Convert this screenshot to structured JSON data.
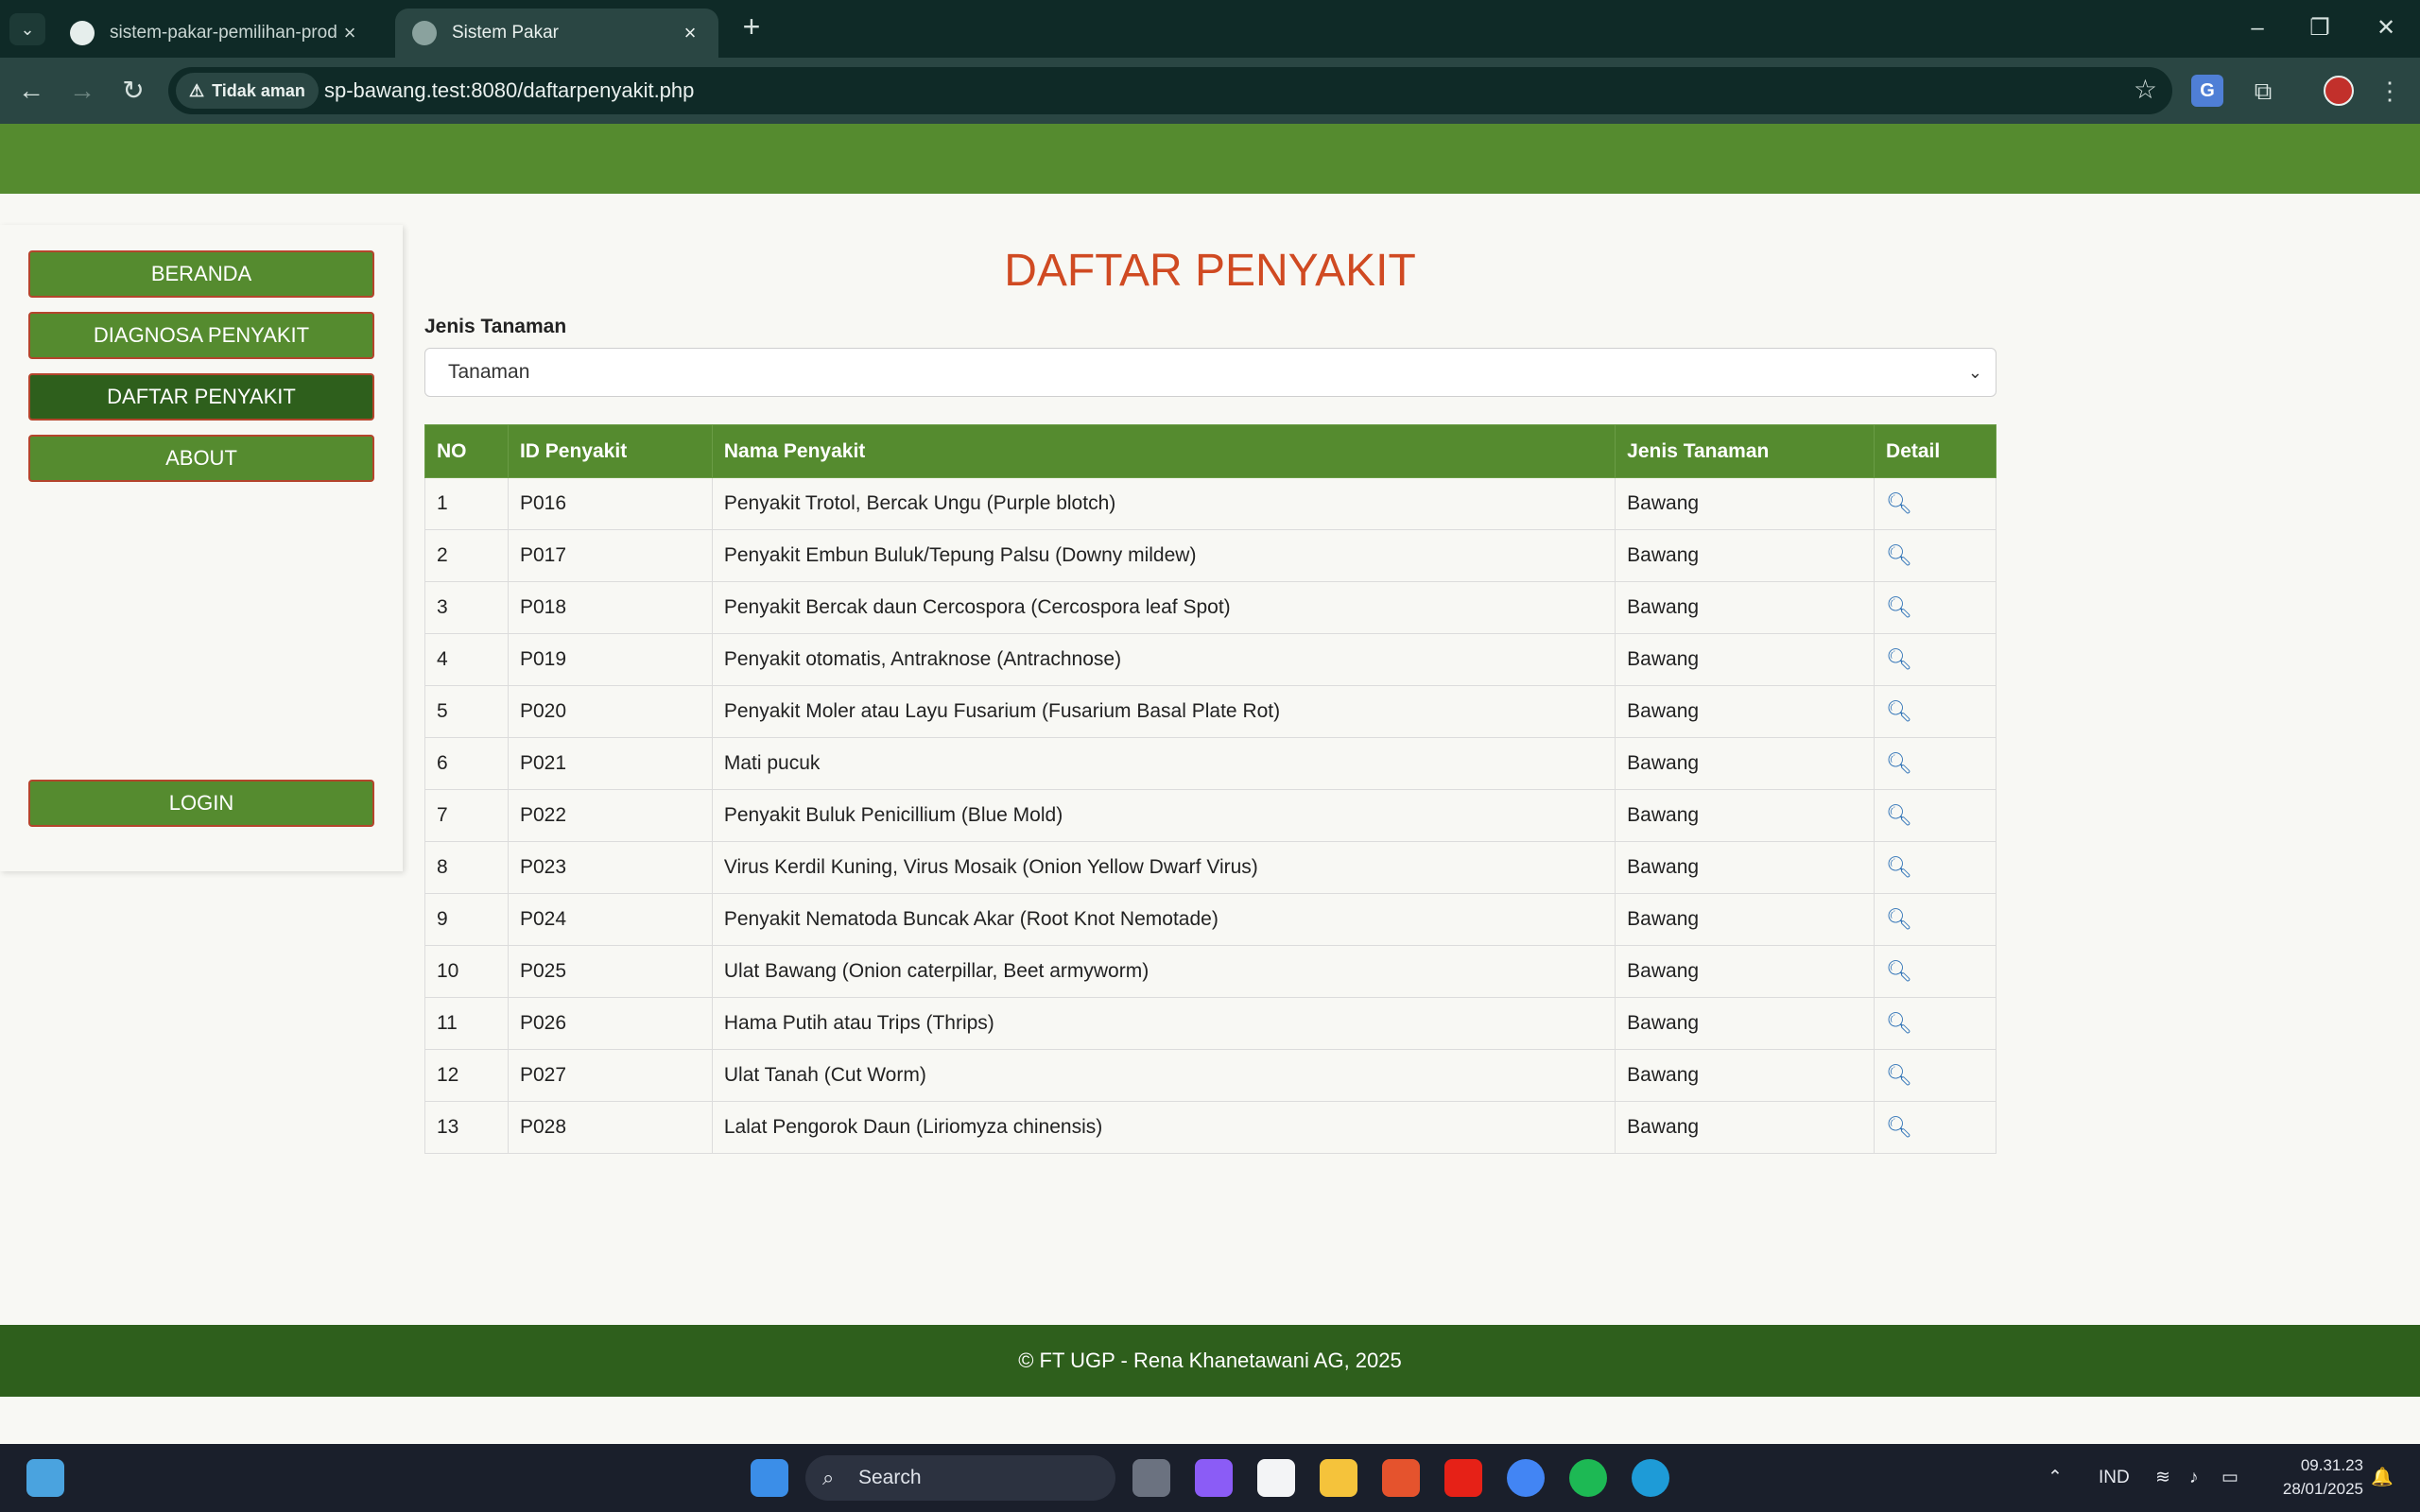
{
  "browser": {
    "tabs": [
      {
        "title": "sistem-pakar-pemilihan-prodi/I"
      },
      {
        "title": "Sistem Pakar"
      }
    ],
    "security_label": "Tidak aman",
    "url": "sp-bawang.test:8080/daftarpenyakit.php"
  },
  "sidebar": {
    "items": [
      {
        "label": "BERANDA"
      },
      {
        "label": "DIAGNOSA PENYAKIT"
      },
      {
        "label": "DAFTAR PENYAKIT"
      },
      {
        "label": "ABOUT"
      }
    ],
    "login_label": "LOGIN"
  },
  "main": {
    "title": "DAFTAR PENYAKIT",
    "filter_label": "Jenis Tanaman",
    "filter_selected": "Tanaman",
    "columns": [
      "NO",
      "ID Penyakit",
      "Nama Penyakit",
      "Jenis Tanaman",
      "Detail"
    ],
    "rows": [
      {
        "no": "1",
        "id": "P016",
        "nama": "Penyakit Trotol, Bercak Ungu (Purple blotch)",
        "jenis": "Bawang"
      },
      {
        "no": "2",
        "id": "P017",
        "nama": "Penyakit Embun Buluk/Tepung Palsu (Downy mildew)",
        "jenis": "Bawang"
      },
      {
        "no": "3",
        "id": "P018",
        "nama": "Penyakit Bercak daun Cercospora (Cercospora leaf Spot)",
        "jenis": "Bawang"
      },
      {
        "no": "4",
        "id": "P019",
        "nama": "Penyakit otomatis, Antraknose (Antrachnose)",
        "jenis": "Bawang"
      },
      {
        "no": "5",
        "id": "P020",
        "nama": "Penyakit Moler atau Layu Fusarium (Fusarium Basal Plate Rot)",
        "jenis": "Bawang"
      },
      {
        "no": "6",
        "id": "P021",
        "nama": "Mati pucuk",
        "jenis": "Bawang"
      },
      {
        "no": "7",
        "id": "P022",
        "nama": "Penyakit Buluk Penicillium (Blue Mold)",
        "jenis": "Bawang"
      },
      {
        "no": "8",
        "id": "P023",
        "nama": "Virus Kerdil Kuning, Virus Mosaik (Onion Yellow Dwarf Virus)",
        "jenis": "Bawang"
      },
      {
        "no": "9",
        "id": "P024",
        "nama": "Penyakit Nematoda Buncak Akar (Root Knot Nemotade)",
        "jenis": "Bawang"
      },
      {
        "no": "10",
        "id": "P025",
        "nama": "Ulat Bawang (Onion caterpillar, Beet armyworm)",
        "jenis": "Bawang"
      },
      {
        "no": "11",
        "id": "P026",
        "nama": "Hama Putih atau Trips (Thrips)",
        "jenis": "Bawang"
      },
      {
        "no": "12",
        "id": "P027",
        "nama": "Ulat Tanah (Cut Worm)",
        "jenis": "Bawang"
      },
      {
        "no": "13",
        "id": "P028",
        "nama": "Lalat Pengorok Daun (Liriomyza chinensis)",
        "jenis": "Bawang"
      }
    ]
  },
  "footer": {
    "text": "© FT UGP - Rena Khanetawani AG, 2025"
  },
  "taskbar": {
    "search_placeholder": "Search",
    "language": "IND",
    "time": "09.31.23",
    "date": "28/01/2025"
  },
  "colors": {
    "brand_green": "#558b2f",
    "dark_green": "#2e5f1c",
    "title_red": "#d04a22",
    "button_border": "#b4452c"
  }
}
